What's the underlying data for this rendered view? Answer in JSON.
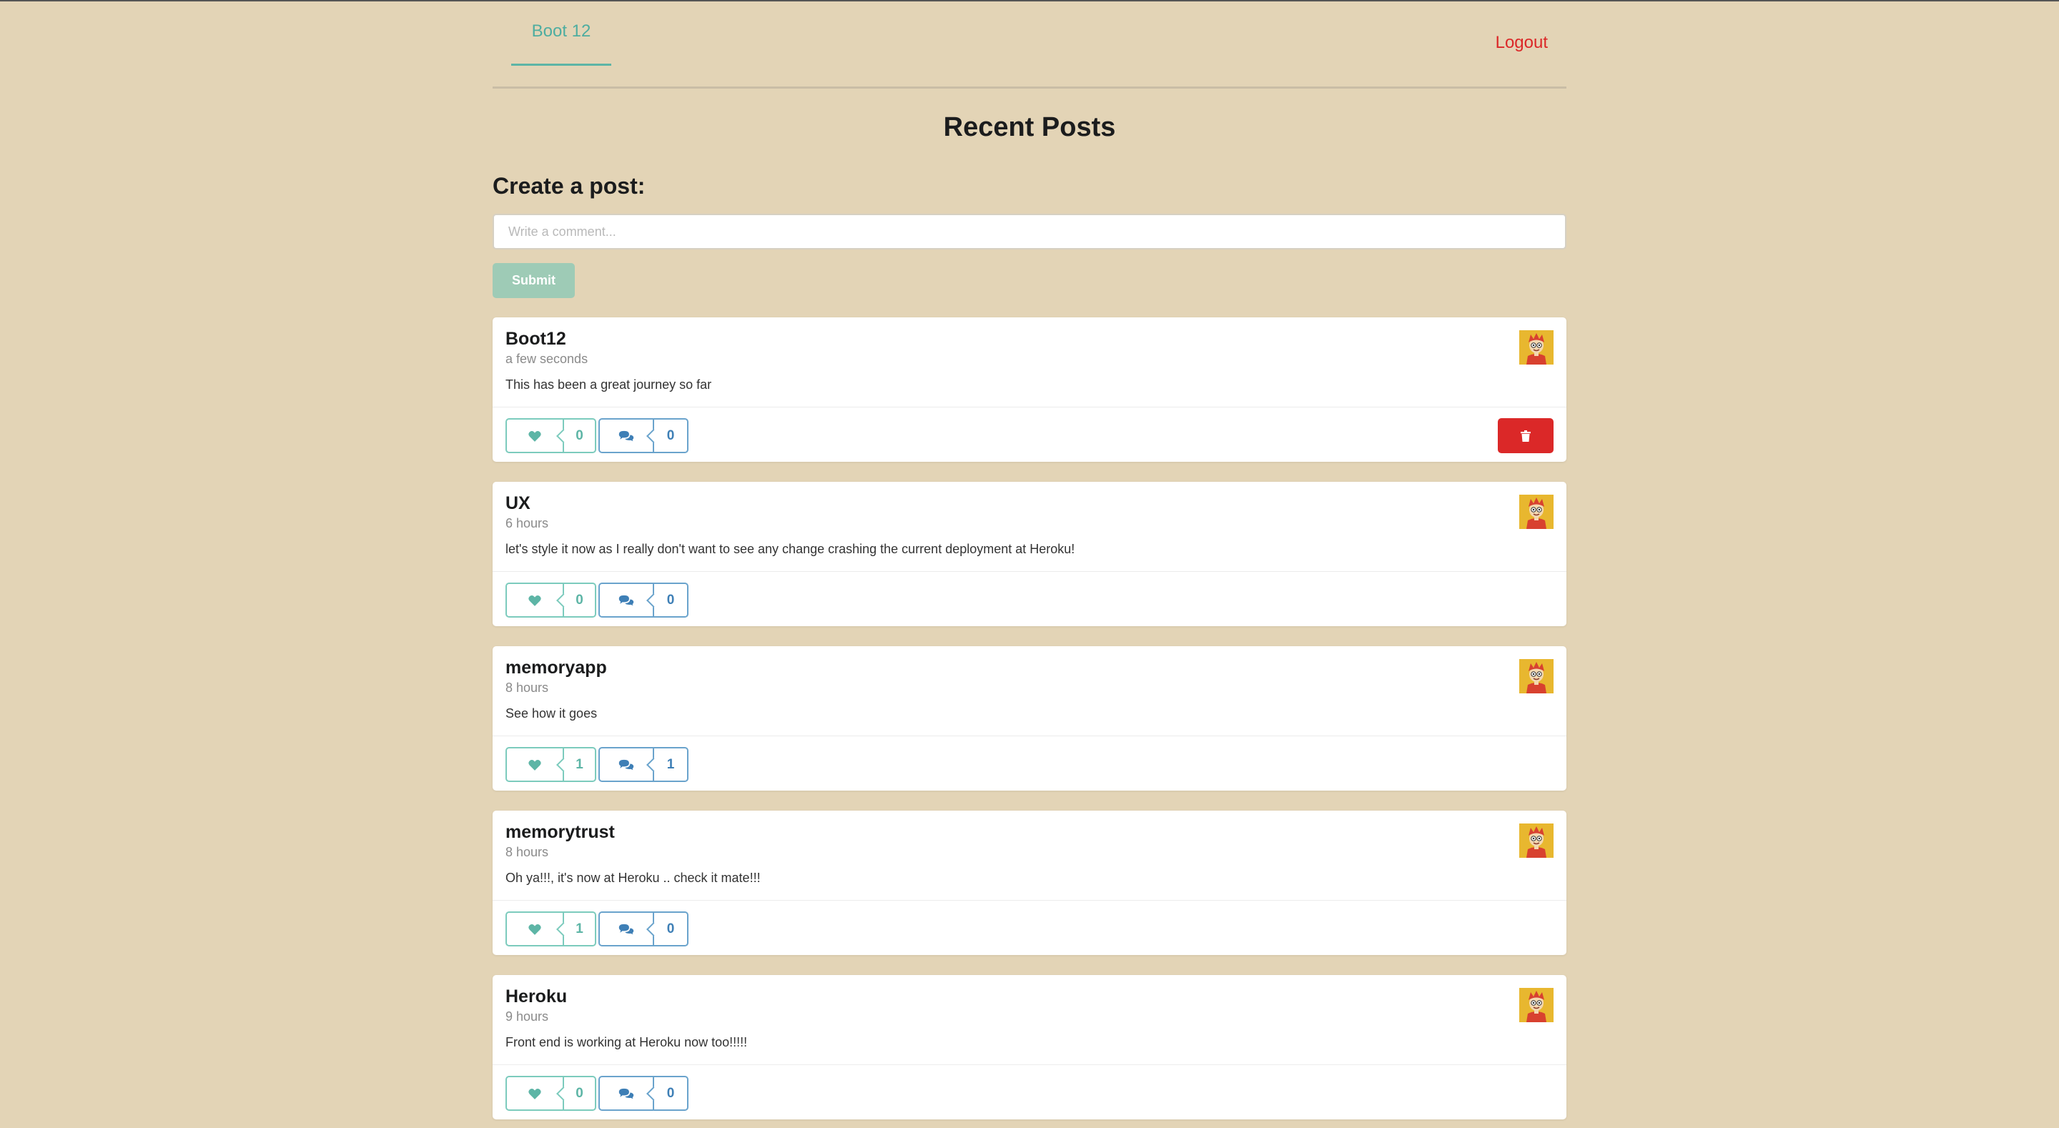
{
  "menu": {
    "home_label": "Boot 12",
    "logout_label": "Logout"
  },
  "page_title": "Recent Posts",
  "create_post": {
    "title": "Create a post:",
    "placeholder": "Write a comment...",
    "submit_label": "Submit"
  },
  "colors": {
    "background": "#e3d4b6",
    "accent_teal": "#5db5a6",
    "accent_blue": "#3e7fb6",
    "danger_red": "#db2828"
  },
  "posts": [
    {
      "author": "Boot12",
      "time": "a few seconds",
      "body": "This has been a great journey so far",
      "likes": "0",
      "comments": "0",
      "has_delete": true,
      "icons": {
        "like": "heart-icon",
        "comment": "comments-icon",
        "delete": "trash-icon"
      }
    },
    {
      "author": "UX",
      "time": "6 hours",
      "body": "let's style it now as I really don't want to see any change crashing the current deployment at Heroku!",
      "likes": "0",
      "comments": "0",
      "has_delete": false
    },
    {
      "author": "memoryapp",
      "time": "8 hours",
      "body": "See how it goes",
      "likes": "1",
      "comments": "1",
      "has_delete": false
    },
    {
      "author": "memorytrust",
      "time": "8 hours",
      "body": "Oh ya!!!, it's now at Heroku .. check it mate!!!",
      "likes": "1",
      "comments": "0",
      "has_delete": false
    },
    {
      "author": "Heroku",
      "time": "9 hours",
      "body": "Front end is working at Heroku now too!!!!!",
      "likes": "0",
      "comments": "0",
      "has_delete": false
    }
  ]
}
